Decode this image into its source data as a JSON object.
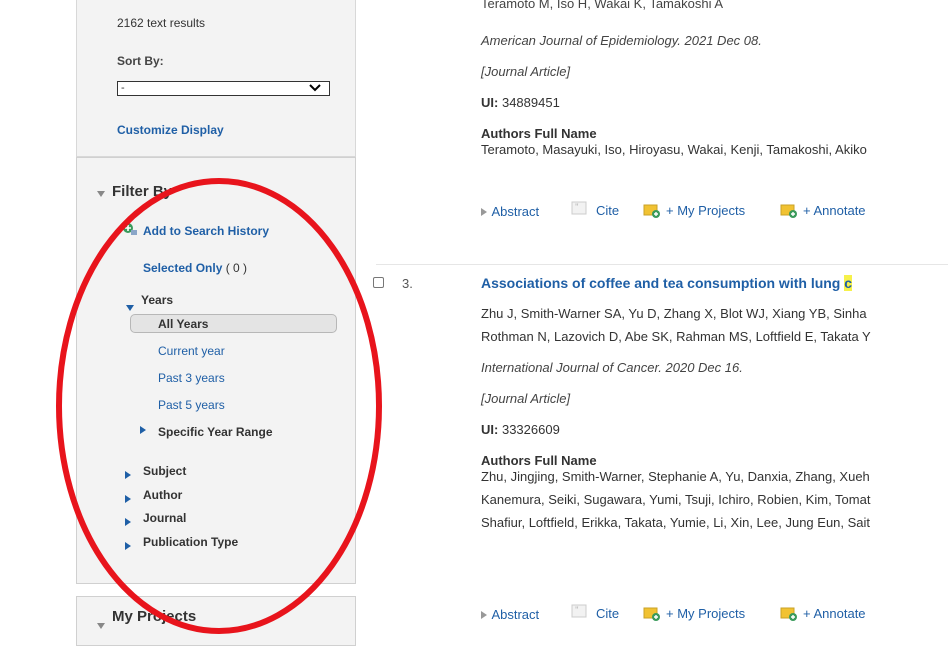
{
  "sidebar": {
    "results_count": "2162 text results",
    "sort_label": "Sort By:",
    "sort_value": "-",
    "customize_display": "Customize Display",
    "filter_title": "Filter By",
    "add_to_history": "Add to Search History",
    "selected_only": "Selected Only",
    "selected_count": "( 0 )",
    "years_label": "Years",
    "year_options": [
      "All Years",
      "Current year",
      "Past 3 years",
      "Past 5 years"
    ],
    "specific_year_range": "Specific Year Range",
    "facets": [
      "Subject",
      "Author",
      "Journal",
      "Publication Type"
    ],
    "my_projects": "My Projects"
  },
  "results": {
    "prev": {
      "authors_partial": "Teramoto M, Iso H, Wakai K, Tamakoshi A",
      "journal": "American Journal of Epidemiology. 2021 Dec 08.",
      "type": "[Journal Article]",
      "ui_label": "UI:",
      "ui_value": "34889451",
      "full_name_label": "Authors Full Name",
      "full_names": "Teramoto, Masayuki, Iso, Hiroyasu, Wakai, Kenji, Tamakoshi, Akiko"
    },
    "item3": {
      "number": "3.",
      "title": "Associations of coffee and tea consumption with lung ",
      "title_highlight": "c",
      "authors_line1": "Zhu J, Smith-Warner SA, Yu D, Zhang X, Blot WJ, Xiang YB, Sinha",
      "authors_line2": "Rothman N, Lazovich D, Abe SK, Rahman MS, Loftfield E, Takata Y",
      "journal": "International Journal of Cancer. 2020 Dec 16.",
      "type": "[Journal Article]",
      "ui_label": "UI:",
      "ui_value": "33326609",
      "full_name_label": "Authors Full Name",
      "full_names_line1": "Zhu, Jingjing, Smith-Warner, Stephanie A, Yu, Danxia, Zhang, Xueh",
      "full_names_line2": "Kanemura, Seiki, Sugawara, Yumi, Tsuji, Ichiro, Robien, Kim, Tomat",
      "full_names_line3": "Shafiur, Loftfield, Erikka, Takata, Yumie, Li, Xin, Lee, Jung Eun, Sait"
    },
    "actions": {
      "abstract": "Abstract",
      "cite": "Cite",
      "my_projects": "+ My Projects",
      "annotate": "+ Annotate"
    }
  },
  "colors": {
    "link": "#1f5fa6",
    "annotation_circle": "#e8141c",
    "highlight": "#f6f14a"
  }
}
